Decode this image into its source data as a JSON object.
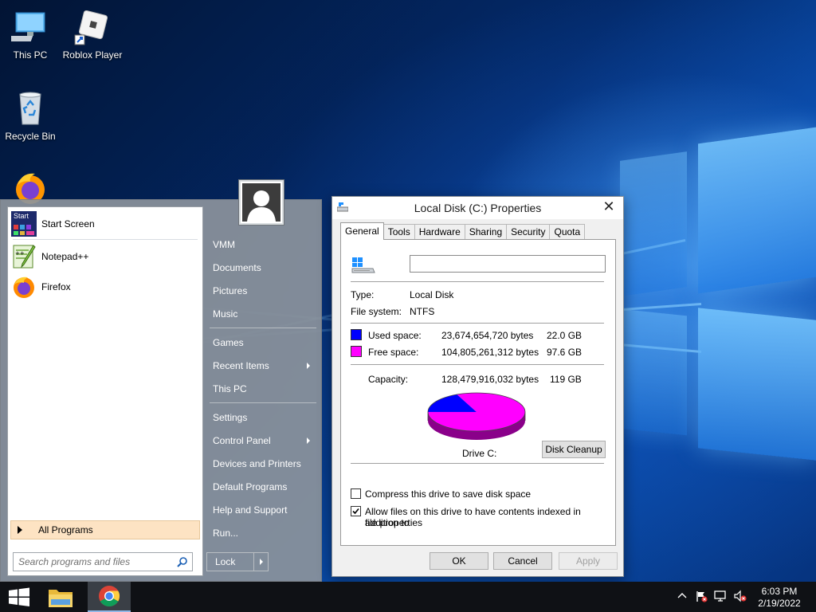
{
  "desktop": {
    "icons": [
      {
        "label": "This PC",
        "icon": "this-pc-icon"
      },
      {
        "label": "Roblox Player",
        "icon": "roblox-icon"
      },
      {
        "label": "Recycle Bin",
        "icon": "recycle-bin-icon"
      }
    ]
  },
  "start_menu": {
    "pinned": [
      {
        "label": "Start Screen",
        "icon": "start-screen-icon"
      },
      {
        "label": "Notepad++",
        "icon": "notepadpp-icon"
      },
      {
        "label": "Firefox",
        "icon": "firefox-icon"
      }
    ],
    "start_tile_text": "Start",
    "all_programs": "All Programs",
    "search_placeholder": "Search programs and files",
    "right_items": [
      {
        "label": "VMM",
        "submenu": false
      },
      {
        "label": "Documents",
        "submenu": false
      },
      {
        "label": "Pictures",
        "submenu": false
      },
      {
        "label": "Music",
        "submenu": false
      },
      {
        "label": "Games",
        "submenu": false
      },
      {
        "label": "Recent Items",
        "submenu": true
      },
      {
        "label": "This PC",
        "submenu": false
      },
      {
        "label": "Settings",
        "submenu": false
      },
      {
        "label": "Control Panel",
        "submenu": true
      },
      {
        "label": "Devices and Printers",
        "submenu": false
      },
      {
        "label": "Default Programs",
        "submenu": false
      },
      {
        "label": "Help and Support",
        "submenu": false
      },
      {
        "label": "Run...",
        "submenu": false
      }
    ],
    "lock_label": "Lock"
  },
  "properties": {
    "title": "Local Disk (C:) Properties",
    "close_glyph": "✕",
    "tabs": [
      "General",
      "Tools",
      "Hardware",
      "Sharing",
      "Security",
      "Quota"
    ],
    "active_tab": "General",
    "label_value": "",
    "type_label": "Type:",
    "type_value": "Local Disk",
    "fs_label": "File system:",
    "fs_value": "NTFS",
    "used_label": "Used space:",
    "used_bytes": "23,674,654,720 bytes",
    "used_gb": "22.0 GB",
    "free_label": "Free space:",
    "free_bytes": "104,805,261,312 bytes",
    "free_gb": "97.6 GB",
    "capacity_label": "Capacity:",
    "capacity_bytes": "128,479,916,032 bytes",
    "capacity_gb": "119 GB",
    "drive_label": "Drive C:",
    "disk_cleanup": "Disk Cleanup",
    "compress_label": "Compress this drive to save disk space",
    "compress_checked": false,
    "index_label_1": "Allow files on this drive to have contents indexed in addition to",
    "index_label_2": "file properties",
    "index_checked": true,
    "used_fraction": 0.184,
    "colors": {
      "used": "#0000ff",
      "free": "#ff00ff"
    },
    "buttons": {
      "ok": "OK",
      "cancel": "Cancel",
      "apply": "Apply"
    }
  },
  "taskbar": {
    "time": "6:03 PM",
    "date": "2/19/2022",
    "apps": [
      "file-explorer-icon",
      "chrome-icon"
    ],
    "tray_icons": [
      "chevron-up-icon",
      "action-center-flag-icon",
      "network-icon",
      "volume-muted-icon"
    ]
  }
}
